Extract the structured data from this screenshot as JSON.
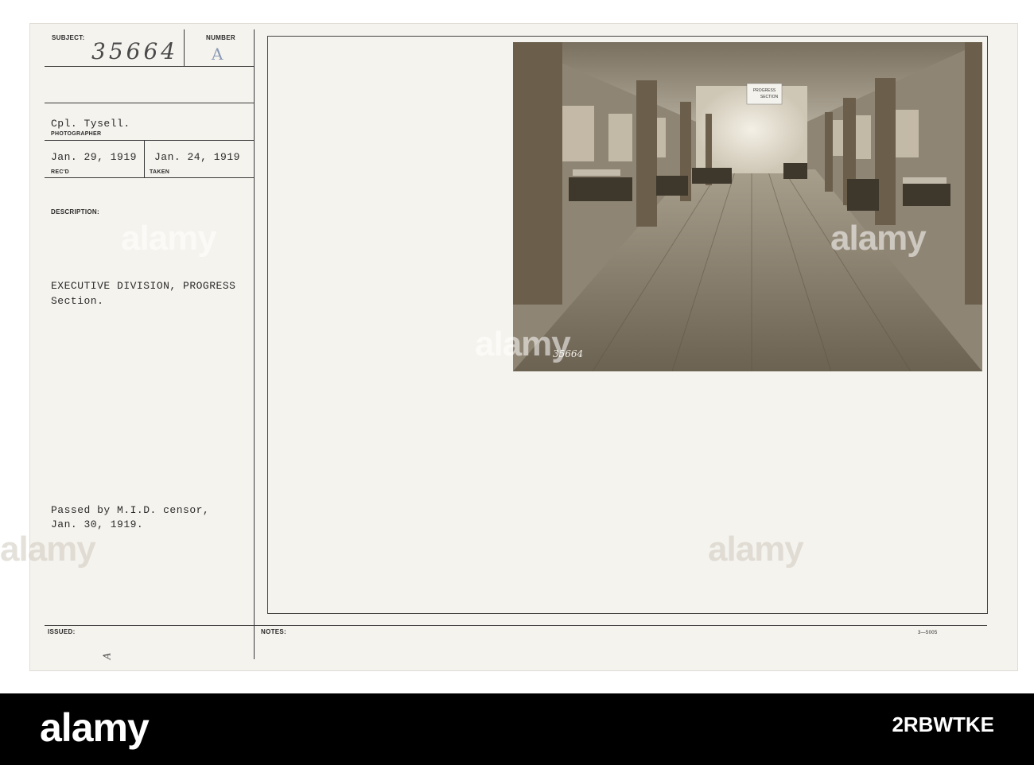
{
  "card": {
    "subject_label": "SUBJECT:",
    "subject_number": "35664",
    "number_label": "NUMBER",
    "number_value": "A",
    "photographer_name": "Cpl. Tysell.",
    "photographer_label": "PHOTOGRAPHER",
    "received_date": "Jan. 29, 1919",
    "received_label": "REC'D",
    "taken_date": "Jan. 24, 1919",
    "taken_label": "TAKEN",
    "description_label": "DESCRIPTION:",
    "description_line1": "EXECUTIVE DIVISION, PROGRESS",
    "description_line2": "Section.",
    "censor_line1": "Passed by M.I.D. censor,",
    "censor_line2": "Jan. 30, 1919.",
    "issued_label": "ISSUED:",
    "notes_label": "NOTES:",
    "form_code": "3—5005",
    "corner_mark": "A"
  },
  "photo": {
    "sign_line1": "PROGRESS",
    "sign_line2": "SECTION",
    "negative_number": "35664"
  },
  "watermark": {
    "text": "alamy"
  },
  "footer": {
    "logo": "alamy",
    "image_id": "2RBWTKE"
  },
  "colors": {
    "card_bg": "#f5f3ee",
    "ink": "#2a2a2a",
    "footer_bg": "#000000"
  }
}
